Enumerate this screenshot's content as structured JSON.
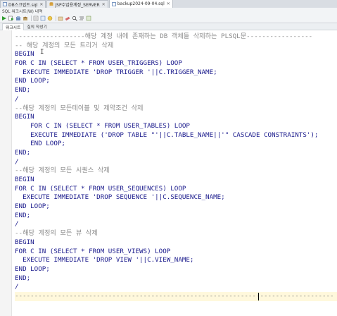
{
  "tabs": [
    {
      "label": "DB스크립트.sql",
      "active": false
    },
    {
      "label": "JSP수업용계정_SERVER",
      "active": false
    },
    {
      "label": "backup2024-09-04.sql",
      "active": true
    }
  ],
  "subbar": {
    "text": "SQL 워크시트(W) 내역"
  },
  "toolbar": {
    "icons": [
      "run-icon",
      "run-script-icon",
      "commit-icon",
      "rollback-icon",
      "tuning-icon",
      "explain-icon",
      "autotrace-icon",
      "clear-icon",
      "eraser-icon",
      "find-icon",
      "format-icon",
      "more-icon"
    ]
  },
  "subtabs": [
    {
      "label": "워크시트",
      "active": true
    },
    {
      "label": "질의 작성기",
      "active": false
    }
  ],
  "editor": {
    "lines": [
      "------------------해당 계정 내에 존재하는 DB 객체들 삭제하는 PLSQL문-----------------",
      "-- 해당 계정의 모든 트리거 삭제",
      "BEGIN",
      "FOR C IN (SELECT * FROM USER_TRIGGERS) LOOP",
      "  EXECUTE IMMEDIATE 'DROP TRIGGER '||C.TRIGGER_NAME;",
      "END LOOP;",
      "END;",
      "/",
      "--해당 계정의 모든테이블 및 제약조건 삭제",
      "BEGIN",
      "    FOR C IN (SELECT * FROM USER_TABLES) LOOP",
      "    EXECUTE IMMEDIATE ('DROP TABLE \"'||C.TABLE_NAME||'\" CASCADE CONSTRAINTS');",
      "    END LOOP;",
      "END;",
      "/",
      "--해당 계정의 모든 시퀀스 삭제",
      "BEGIN",
      "FOR C IN (SELECT * FROM USER_SEQUENCES) LOOP",
      "  EXECUTE IMMEDIATE 'DROP SEQUENCE '||C.SEQUENCE_NAME;",
      "END LOOP;",
      "END;",
      "/",
      "--해당 계정의 모든 뷰 삭제",
      "BEGIN",
      "FOR C IN (SELECT * FROM USER_VIEWS) LOOP",
      "  EXECUTE IMMEDIATE 'DROP VIEW '||C.VIEW_NAME;",
      "END LOOP;",
      "END;",
      "/",
      "----------------------------------------------------------------------------------"
    ]
  }
}
